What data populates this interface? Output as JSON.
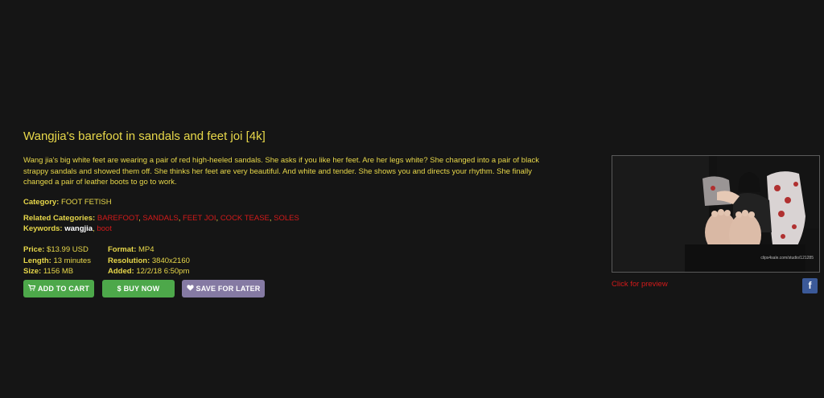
{
  "product": {
    "title": "Wangjia's barefoot in sandals and feet joi [4k]",
    "description": "Wang jia's big white feet are wearing a pair of red high-heeled sandals. She asks if you like her feet. Are her legs white? She changed into a pair of black strappy sandals and showed them off. She thinks her feet are very beautiful. And white and tender. She shows you and directs your rhythm. She finally changed a pair of leather boots to go to work.",
    "category_label": "Category:",
    "category_value": "FOOT FETISH",
    "related_label": "Related Categories:",
    "related": [
      "BAREFOOT",
      "SANDALS",
      "FEET JOI",
      "COCK TEASE",
      "SOLES"
    ],
    "keywords_label": "Keywords:",
    "keywords": [
      "wangjia",
      "boot"
    ]
  },
  "details": {
    "price_label": "Price:",
    "price": "$13.99 USD",
    "length_label": "Length:",
    "length": "13 minutes",
    "size_label": "Size:",
    "size": "1156 MB",
    "format_label": "Format:",
    "format": "MP4",
    "resolution_label": "Resolution:",
    "resolution": "3840x2160",
    "added_label": "Added:",
    "added": "12/2/18 6:50pm"
  },
  "buttons": {
    "add_to_cart": "ADD TO CART",
    "buy_now": "$ BUY NOW",
    "save_for_later": "SAVE FOR LATER"
  },
  "preview": {
    "link_text": "Click for preview",
    "watermark": "clips4sale.com/studio/121285"
  },
  "share": {
    "facebook_glyph": "f"
  },
  "colors": {
    "background": "#151515",
    "text": "#e8d84a",
    "link_red": "#d41a1a",
    "button_green": "#4da84a",
    "button_purple": "#857aa3",
    "facebook": "#3b5998"
  }
}
